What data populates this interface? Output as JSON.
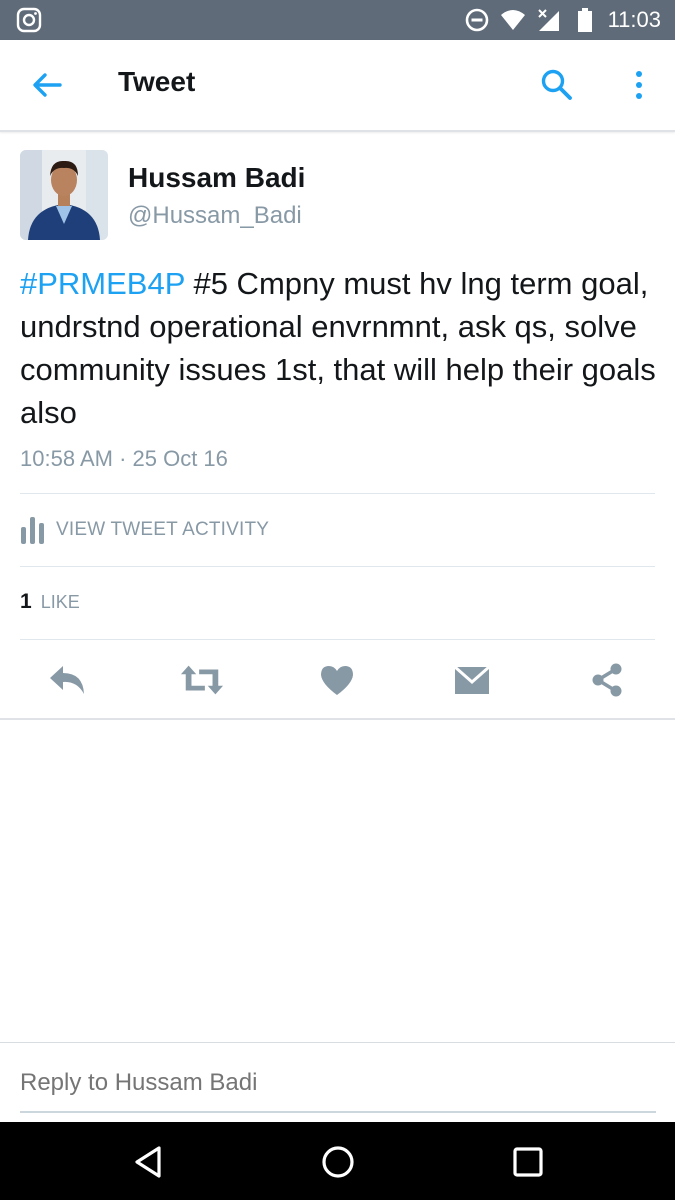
{
  "status_bar": {
    "left_icon": "instagram-icon",
    "icons": [
      "do-not-disturb-icon",
      "wifi-icon",
      "signal-icon",
      "battery-icon"
    ],
    "time": "11:03"
  },
  "app_bar": {
    "title": "Tweet",
    "back_icon": "back-arrow-icon",
    "search_icon": "search-icon",
    "more_icon": "more-vert-icon"
  },
  "tweet": {
    "author_name": "Hussam Badi",
    "author_handle": "@Hussam_Badi",
    "hashtag": "#PRMEB4P",
    "text": " #5 Cmpny must hv lng term goal, undrstnd operational envrnmnt, ask qs, solve community issues 1st, that will help their goals also",
    "timestamp": "10:58 AM · 25 Oct 16"
  },
  "activity": {
    "label": "VIEW TWEET ACTIVITY",
    "icon": "bar-chart-icon"
  },
  "likes": {
    "count": "1",
    "label": "LIKE"
  },
  "actions": [
    {
      "name": "reply",
      "icon": "reply-icon"
    },
    {
      "name": "retweet",
      "icon": "retweet-icon"
    },
    {
      "name": "like",
      "icon": "heart-icon"
    },
    {
      "name": "direct-message",
      "icon": "envelope-icon"
    },
    {
      "name": "share",
      "icon": "share-icon"
    }
  ],
  "reply": {
    "placeholder": "Reply to Hussam Badi"
  },
  "nav_bar": {
    "icons": [
      "nav-back-icon",
      "nav-home-icon",
      "nav-recents-icon"
    ]
  },
  "colors": {
    "accent": "#1da1f2",
    "status_bar": "#5f6b78",
    "icon_gray": "#8899a6"
  }
}
